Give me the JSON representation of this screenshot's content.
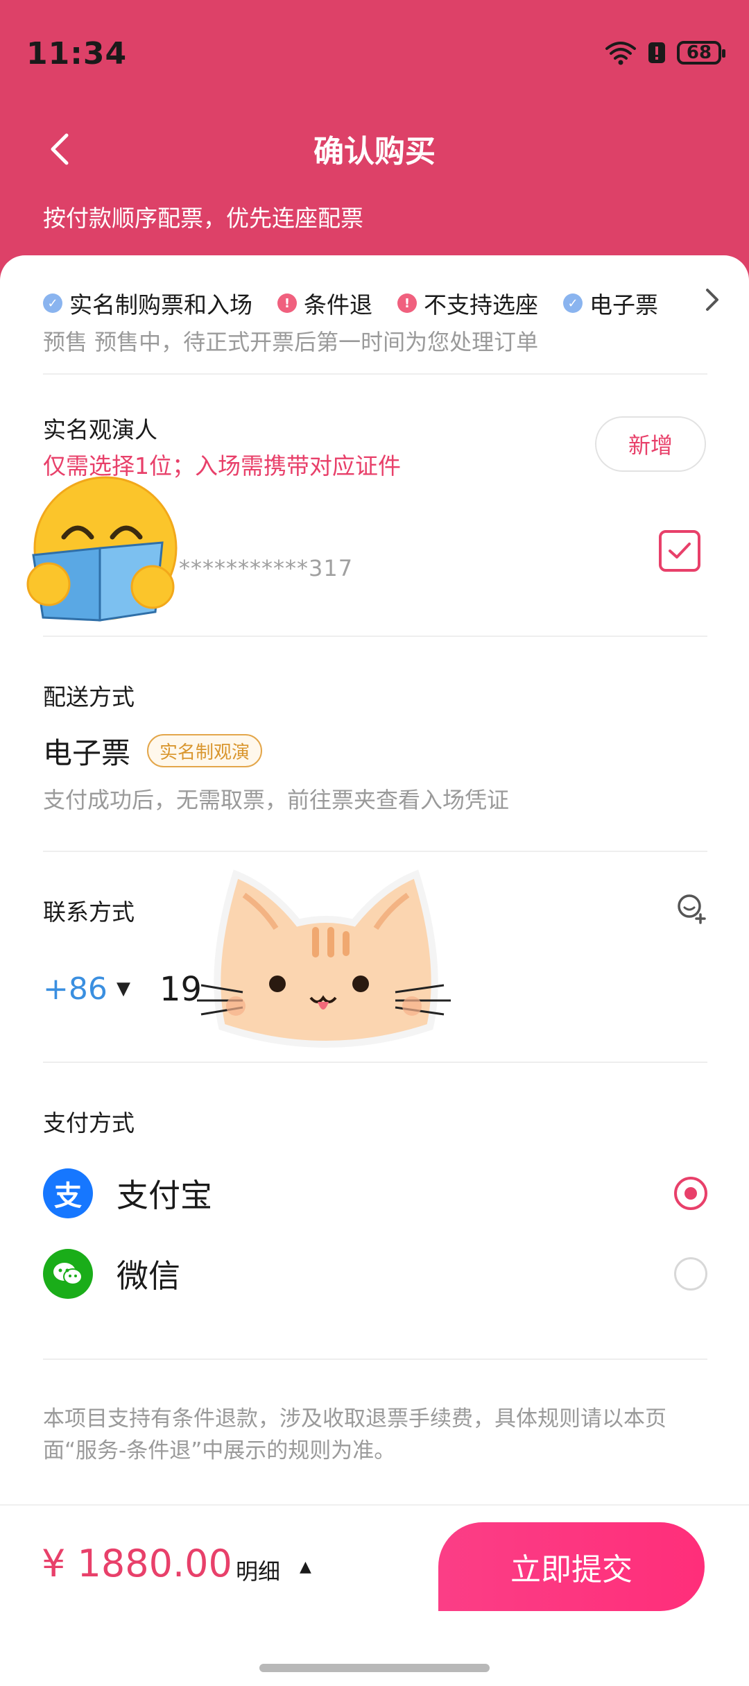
{
  "status_bar": {
    "time": "11:34",
    "battery": "68"
  },
  "header": {
    "title": "确认购买",
    "subtitle": "按付款顺序配票，优先连座配票"
  },
  "service_tags": [
    {
      "label": "实名制购票和入场",
      "kind": "info",
      "color": "#8ab4ef"
    },
    {
      "label": "条件退",
      "kind": "warn",
      "color": "#f0607e"
    },
    {
      "label": "不支持选座",
      "kind": "warn",
      "color": "#f0607e"
    },
    {
      "label": "电子票",
      "kind": "info",
      "color": "#8ab4ef"
    }
  ],
  "presale_note": "预售 预售中，待正式开票后第一时间为您处理订单",
  "attendee": {
    "section_title": "实名观演人",
    "hint": "仅需选择1位；入场需携带对应证件",
    "add_label": "新增",
    "id_masked": "***********317",
    "checked": true
  },
  "delivery": {
    "section_title": "配送方式",
    "type": "电子票",
    "badge": "实名制观演",
    "description": "支付成功后，无需取票，前往票夹查看入场凭证"
  },
  "contact": {
    "section_title": "联系方式",
    "country_code": "+86",
    "phone_partial": "19"
  },
  "payment": {
    "section_title": "支付方式",
    "methods": [
      {
        "label": "支付宝",
        "selected": true,
        "logo_color": "#1677ff",
        "logo_glyph": "支"
      },
      {
        "label": "微信",
        "selected": false,
        "logo_color": "#1aad19",
        "logo_glyph": "微"
      }
    ]
  },
  "refund_note": "本项目支持有条件退款，涉及收取退票手续费，具体规则请以本页面“服务-条件退”中展示的规则为准。",
  "footer": {
    "price": "¥ 1880.00",
    "detail_label": "明细",
    "submit_label": "立即提交"
  },
  "colors": {
    "brand": "#dd4168",
    "accent": "#e8406a",
    "link_blue": "#3a8fe0"
  }
}
